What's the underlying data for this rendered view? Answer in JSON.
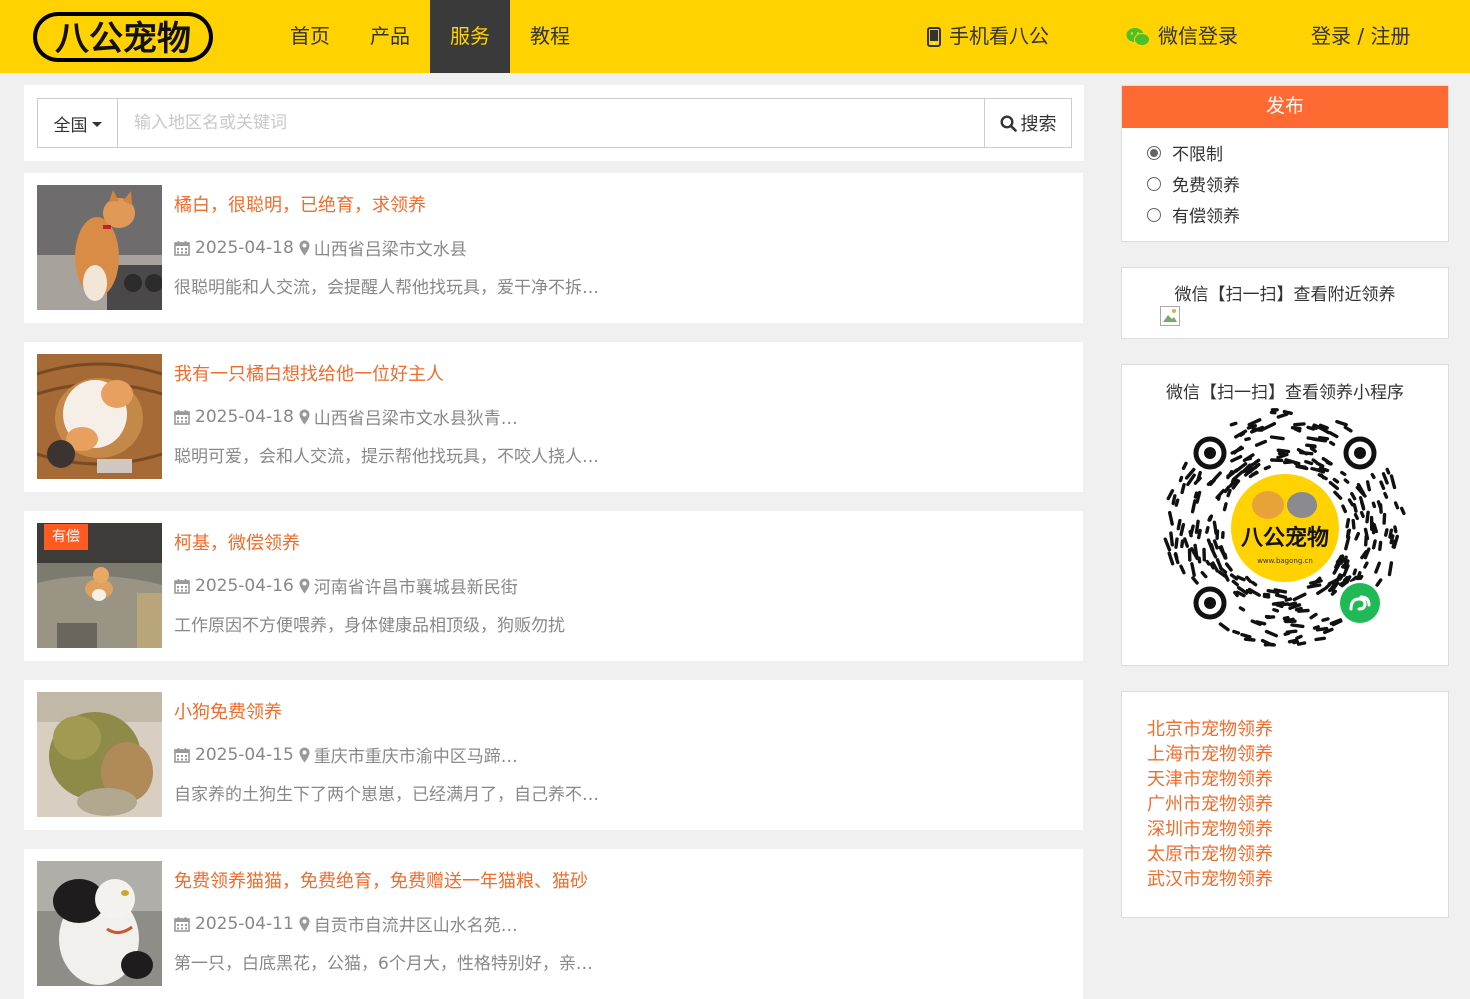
{
  "brand": {
    "logo_text": "八公宠物"
  },
  "nav": {
    "items": [
      {
        "label": "首页",
        "active": false
      },
      {
        "label": "产品",
        "active": false
      },
      {
        "label": "服务",
        "active": true
      },
      {
        "label": "教程",
        "active": false
      }
    ]
  },
  "topright": {
    "mobile_label": "手机看八公",
    "wechat_login_label": "微信登录",
    "login_register_label": "登录 / 注册"
  },
  "search": {
    "region_label": "全国",
    "input_placeholder": "输入地区名或关键词",
    "input_value": "",
    "button_label": "搜索"
  },
  "listings": [
    {
      "title": "橘白，很聪明，已绝育，求领养",
      "date": "2025-04-18",
      "location": "山西省吕梁市文水县",
      "desc": "很聪明能和人交流，会提醒人帮他找玩具，爱干净不拆…",
      "badge": "",
      "image": "orange-white-cat"
    },
    {
      "title": "我有一只橘白想找给他一位好主人",
      "date": "2025-04-18",
      "location": "山西省吕梁市文水县狄青…",
      "desc": "聪明可爱，会和人交流，提示帮他找玩具，不咬人挠人…",
      "badge": "",
      "image": "cat-in-basket"
    },
    {
      "title": "柯基，微偿领养",
      "date": "2025-04-16",
      "location": "河南省许昌市襄城县新民街",
      "desc": "工作原因不方便喂养，身体健康品相顶级，狗贩勿扰",
      "badge": "有偿",
      "image": "corgi-puppy"
    },
    {
      "title": "小狗免费领养",
      "date": "2025-04-15",
      "location": "重庆市重庆市渝中区马蹄…",
      "desc": "自家养的土狗生下了两个崽崽，已经满月了，自己养不…",
      "badge": "",
      "image": "puppy"
    },
    {
      "title": "免费领养猫猫，免费绝育，免费赠送一年猫粮、猫砂",
      "date": "2025-04-11",
      "location": "自贡市自流井区山水名苑…",
      "desc": "第一只，白底黑花，公猫，6个月大，性格特别好，亲…",
      "badge": "",
      "image": "black-white-cat"
    }
  ],
  "sidebar": {
    "publish": {
      "header": "发布",
      "options": [
        {
          "label": "不限制",
          "checked": true
        },
        {
          "label": "免费领养",
          "checked": false
        },
        {
          "label": "有偿领养",
          "checked": false
        }
      ]
    },
    "nearby_qr": {
      "title": "微信【扫一扫】查看附近领养"
    },
    "miniprogram_qr": {
      "title": "微信【扫一扫】查看领养小程序",
      "center_text": "八公宠物",
      "center_url": "www.bagong.cn"
    },
    "city_links": [
      "北京市宠物领养",
      "上海市宠物领养",
      "天津市宠物领养",
      "广州市宠物领养",
      "深圳市宠物领养",
      "太原市宠物领养",
      "武汉市宠物领养"
    ]
  },
  "colors": {
    "topbar": "#ffd200",
    "nav_active_bg": "#3a3a3a",
    "accent_orange": "#f06c2d",
    "publish_header": "#ff6a33",
    "badge": "#ff5a22"
  }
}
